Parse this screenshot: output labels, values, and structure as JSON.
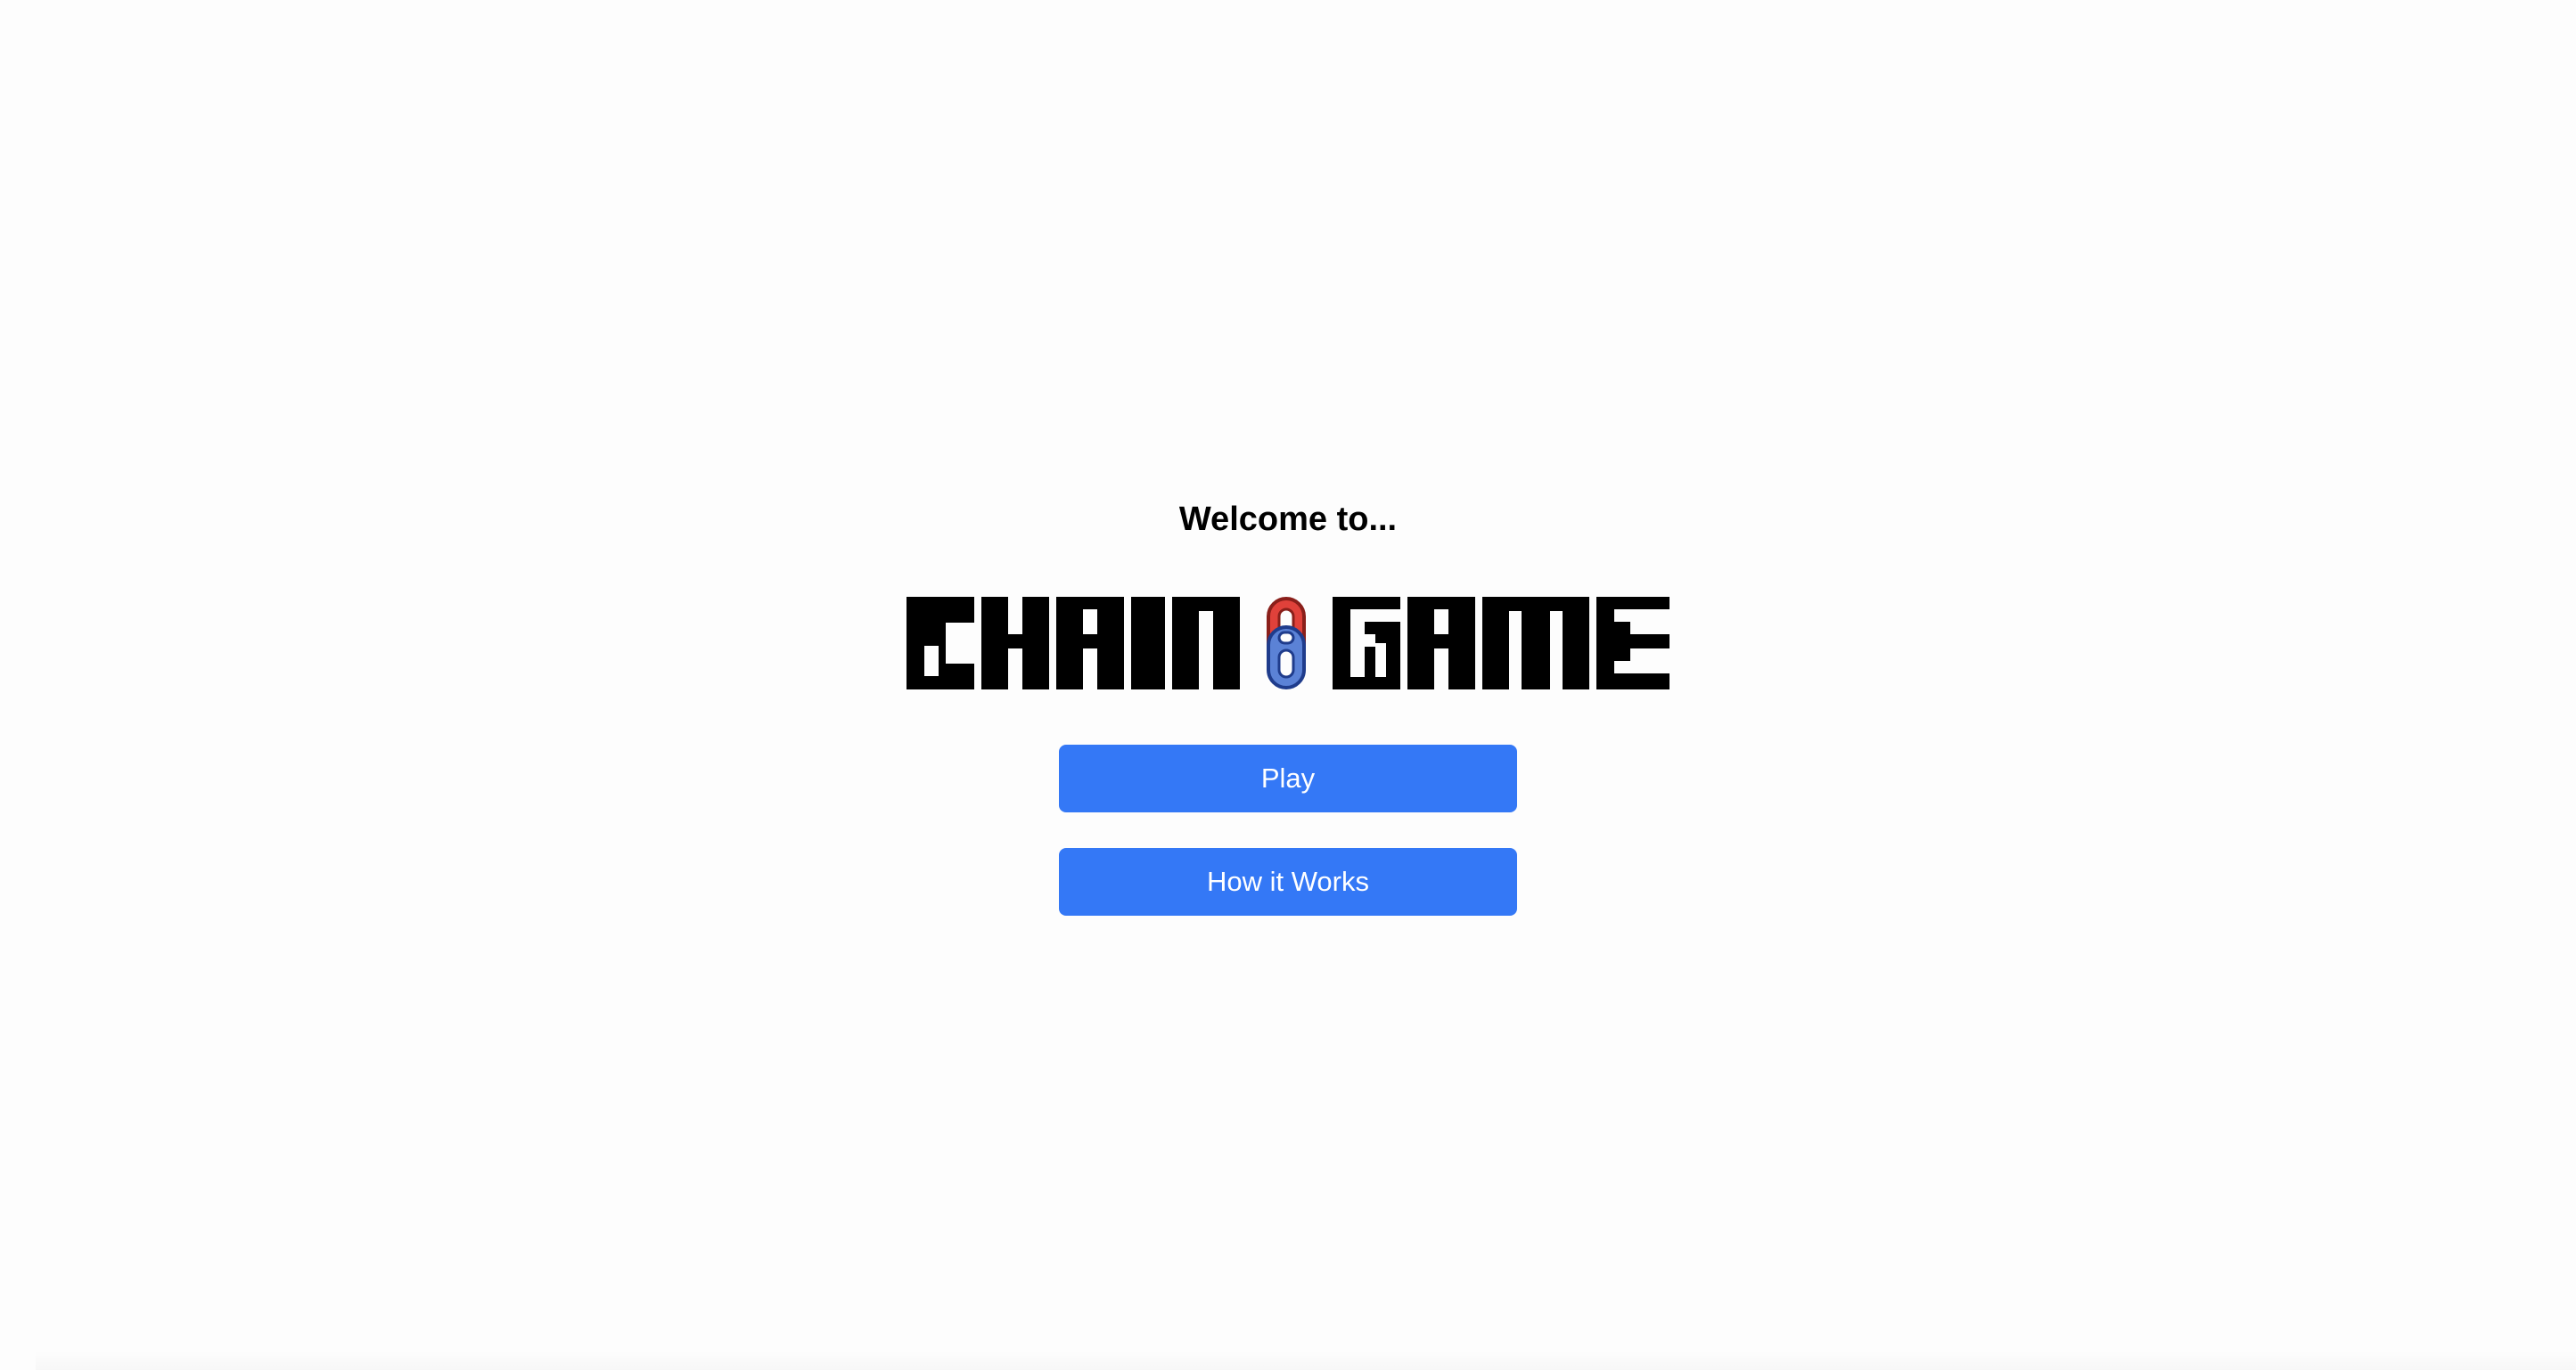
{
  "welcome": {
    "text": "Welcome to..."
  },
  "logo": {
    "text": "CHAIN GAME",
    "icon": "chain-link-icon",
    "link_colors": {
      "top": "#e0413a",
      "bottom": "#5b82d6",
      "outline": "#1f3c8c"
    }
  },
  "buttons": {
    "play_label": "Play",
    "how_label": "How it Works",
    "color": "#3478f6",
    "text_color": "#ffffff"
  }
}
